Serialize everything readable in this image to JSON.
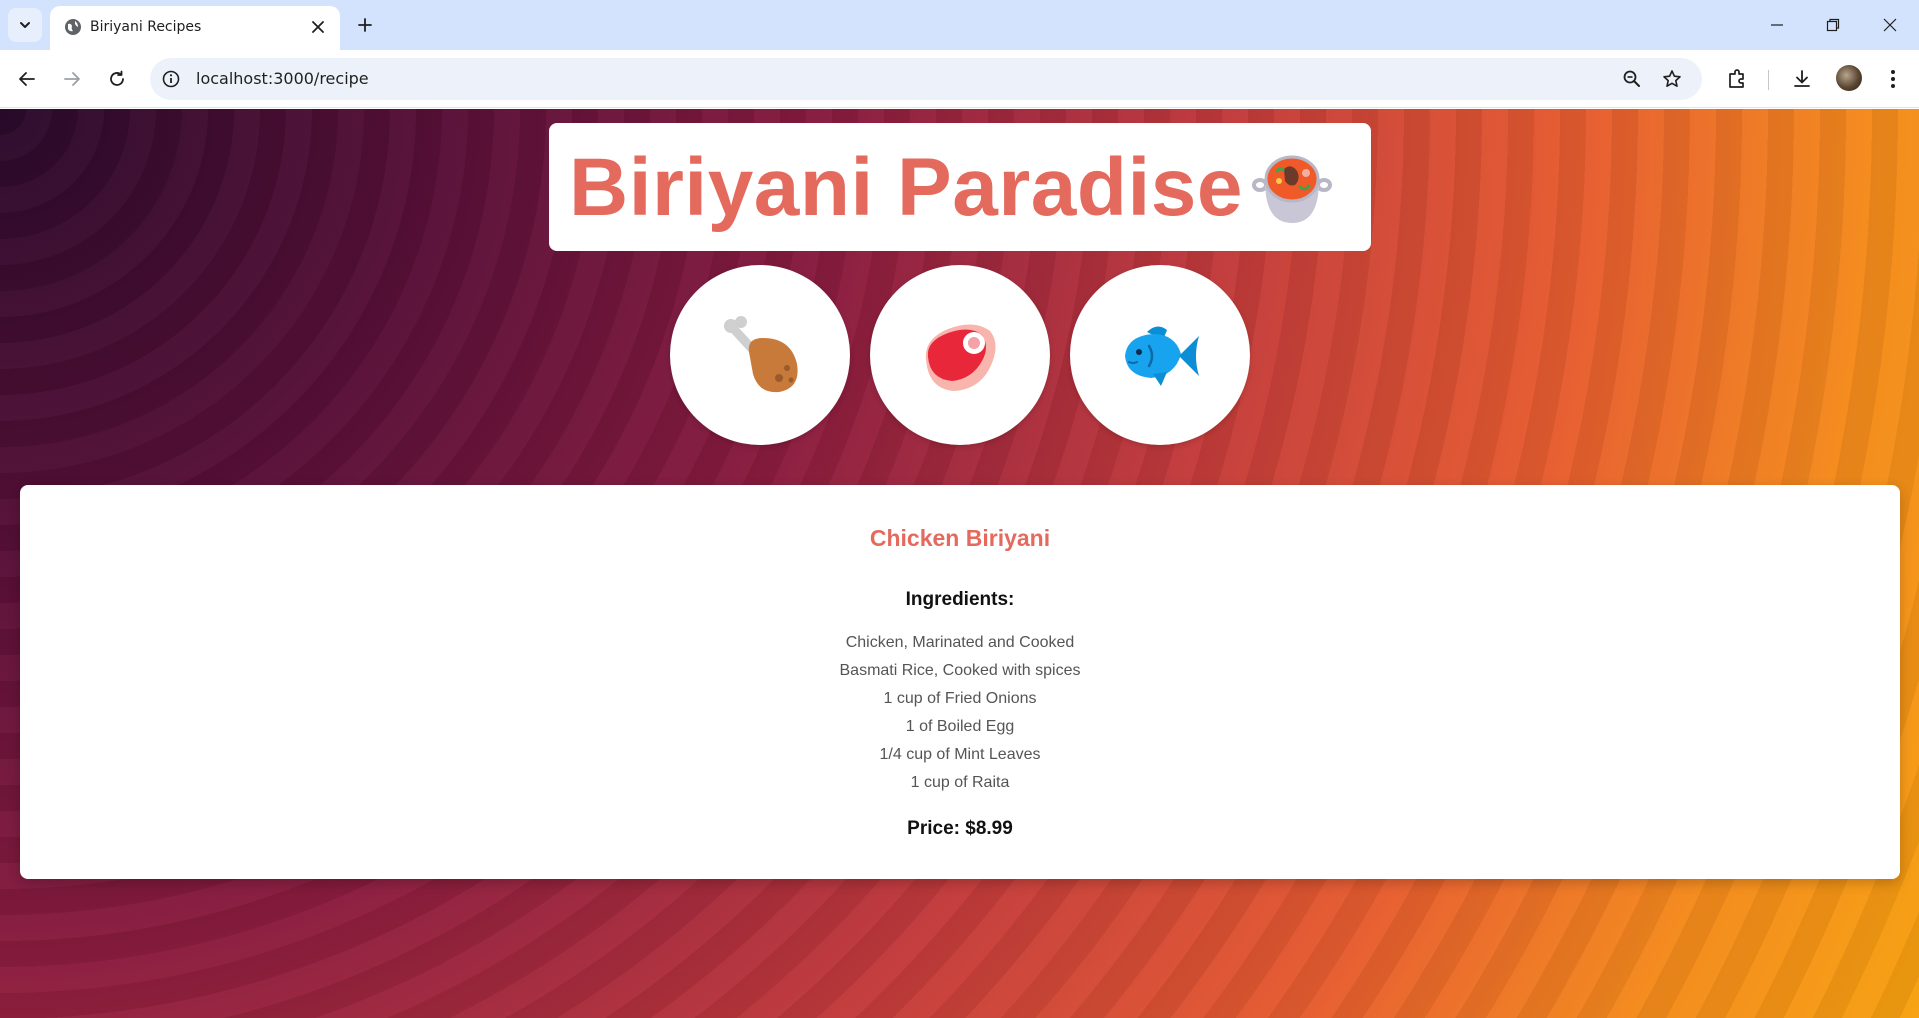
{
  "browser": {
    "tab_title": "Biriyani Recipes",
    "url": "localhost:3000/recipe"
  },
  "page": {
    "brand_title": "Biriyani Paradise",
    "brand_emoji": "stew-pot-icon",
    "categories": [
      {
        "name": "chicken",
        "icon": "poultry-leg-icon"
      },
      {
        "name": "mutton",
        "icon": "meat-cut-icon"
      },
      {
        "name": "fish",
        "icon": "fish-icon"
      }
    ],
    "recipe": {
      "name": "Chicken Biriyani",
      "ingredients_heading": "Ingredients:",
      "ingredients": [
        "Chicken, Marinated and Cooked",
        "Basmati Rice, Cooked with spices",
        "1 cup of Fried Onions",
        "1 of Boiled Egg",
        "1/4 cup of Mint Leaves",
        "1 cup of Raita"
      ],
      "price_text": "Price: $8.99"
    }
  },
  "colors": {
    "accent": "#e56a5e",
    "tabstrip": "#d3e3fd"
  }
}
